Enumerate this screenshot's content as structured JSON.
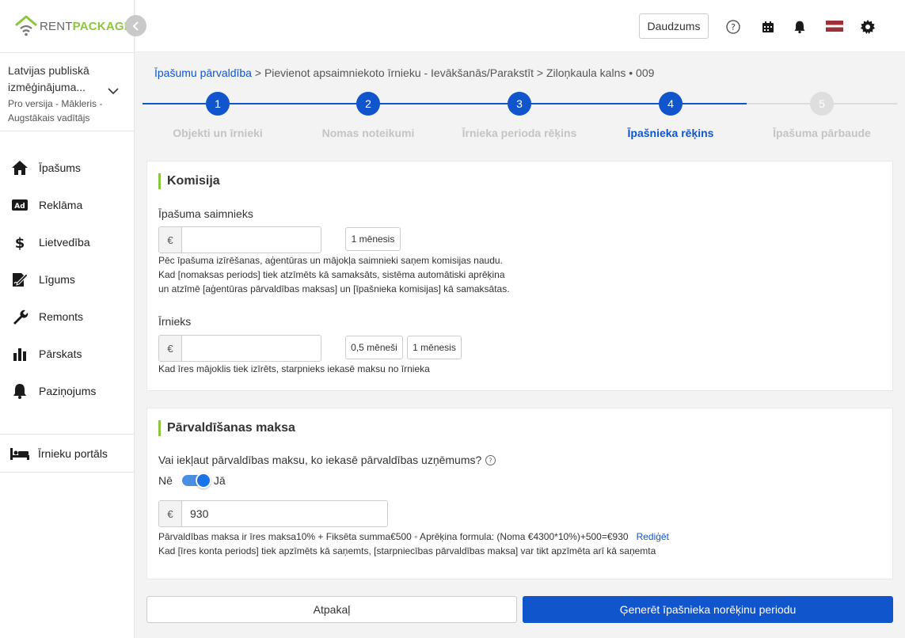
{
  "app": {
    "logo_rent": "RENT",
    "logo_package": "PACKAGE",
    "brand_green": "#8cc63f",
    "brand_blue": "#1155cc"
  },
  "sidebar": {
    "org_name": "Latvijas publiskā izmēģinājuma...",
    "org_role": "Pro versija - Mākleris - Augstākais vadītājs",
    "items": [
      {
        "label": "Īpašums",
        "icon": "home-icon"
      },
      {
        "label": "Reklāma",
        "icon": "ad-icon"
      },
      {
        "label": "Lietvedība",
        "icon": "dollar-icon"
      },
      {
        "label": "Līgums",
        "icon": "contract-icon"
      },
      {
        "label": "Remonts",
        "icon": "wrench-icon"
      },
      {
        "label": "Pārskats",
        "icon": "bar-chart-icon"
      },
      {
        "label": "Paziņojums",
        "icon": "bell-icon"
      }
    ],
    "portal_label": "Īrnieku portāls"
  },
  "topbar": {
    "qty_button": "Daudzums"
  },
  "breadcrumb": {
    "root": "Īpašumu pārvaldība",
    "sep": " > ",
    "step": "Pievienot apsaimniekoto īrnieku - Ievākšanās/Parakstīt",
    "property": "Ziloņkaula kalns • 009"
  },
  "stepper": {
    "steps": [
      {
        "num": "1",
        "label": "Objekti un īrnieki"
      },
      {
        "num": "2",
        "label": "Nomas noteikumi"
      },
      {
        "num": "3",
        "label": "Īrnieka perioda rēķins"
      },
      {
        "num": "4",
        "label": "Īpašnieka rēķins"
      },
      {
        "num": "5",
        "label": "Īpašuma pārbaude"
      }
    ],
    "current": 4
  },
  "commission": {
    "title": "Komisija",
    "owner_label": "Īpašuma saimnieks",
    "currency": "€",
    "owner_value": "",
    "owner_chip": "1 mēnesis",
    "owner_help_1": "Pēc īpašuma izīrēšanas, aģentūras un mājokļa saimnieki saņem komisijas naudu.",
    "owner_help_2": "Kad [nomaksas periods] tiek atzīmēts kā samaksāts, sistēma automātiski aprēķina",
    "owner_help_3": "un atzīmē [aģentūras pārvaldības maksas] un [īpašnieka komisijas] kā samaksātas.",
    "tenant_label": "Īrnieks",
    "tenant_value": "",
    "tenant_chip_half": "0,5 mēneši",
    "tenant_chip_one": "1 mēnesis",
    "tenant_help": "Kad īres mājoklis tiek izīrēts, starpnieks iekasē maksu no īrnieka"
  },
  "management": {
    "title": "Pārvaldīšanas maksa",
    "question": "Vai iekļaut pārvaldības maksu, ko iekasē pārvaldības uzņēmums?",
    "no_label": "Nē",
    "yes_label": "Jā",
    "toggle_on": true,
    "currency": "€",
    "amount": "930",
    "formula": "Pārvaldības maksa ir īres maksa10% + Fiksēta summa€500 ◦ Aprēķina formula: (Noma €4300*10%)+500=€930",
    "edit_link": "Rediģēt",
    "help": "Kad [īres konta periods] tiek apzīmēts kā saņemts, [starpniecības pārvaldības maksa] var tikt apzīmēta arī kā saņemta"
  },
  "footer": {
    "back_button": "Atpakaļ",
    "generate_button": "Ģenerēt īpašnieka norēķinu periodu"
  }
}
